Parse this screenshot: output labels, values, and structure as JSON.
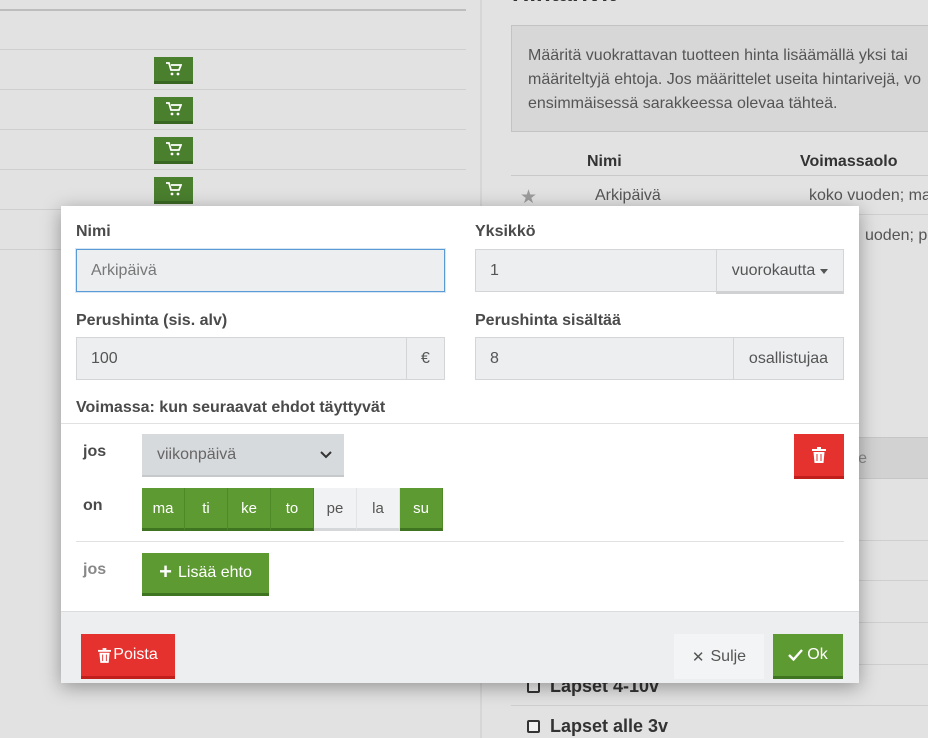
{
  "background": {
    "heading": "Hintarivit",
    "info_text_lines": [
      "Määritä vuokrattavan tuotteen hinta lisäämällä yksi tai",
      "määriteltyjä ehtoja. Jos määrittelet useita hintarivejä, vo",
      "ensimmäisessä sarakkeessa olevaa tähteä."
    ],
    "table": {
      "col_name": "Nimi",
      "col_validity": "Voimassaolo",
      "rows": [
        {
          "name": "Arkipäivä",
          "validity": "koko vuoden; ma"
        },
        {
          "name": "",
          "validity": "uoden; pe"
        }
      ]
    },
    "ghost_input_text": "lle",
    "checkbox_items": [
      "Lapset 4-10v",
      "Lapset alle 3v"
    ]
  },
  "modal": {
    "name_label": "Nimi",
    "name_value": "Arkipäivä",
    "unit_label": "Yksikkö",
    "unit_value": "1",
    "unit_dropdown": "vuorokautta",
    "price_label": "Perushinta (sis. alv)",
    "price_value": "100",
    "currency": "€",
    "includes_label": "Perushinta sisältää",
    "includes_value": "8",
    "includes_unit": "osallistujaa",
    "validity_label": "Voimassa: kun seuraavat ehdot täyttyvät",
    "condition": {
      "if_word": "jos",
      "type_selected": "viikonpäivä",
      "on_word": "on",
      "days": [
        {
          "label": "ma",
          "active": true
        },
        {
          "label": "ti",
          "active": true
        },
        {
          "label": "ke",
          "active": true
        },
        {
          "label": "to",
          "active": true
        },
        {
          "label": "pe",
          "active": false
        },
        {
          "label": "la",
          "active": false
        },
        {
          "label": "su",
          "active": true
        }
      ]
    },
    "add_condition_word": "jos",
    "add_condition_button": "Lisää ehto",
    "footer": {
      "delete_button": "Poista",
      "close_button": "Sulje",
      "ok_button": "Ok"
    }
  },
  "colors": {
    "green": "#5e9a32",
    "red": "#e5322f"
  }
}
